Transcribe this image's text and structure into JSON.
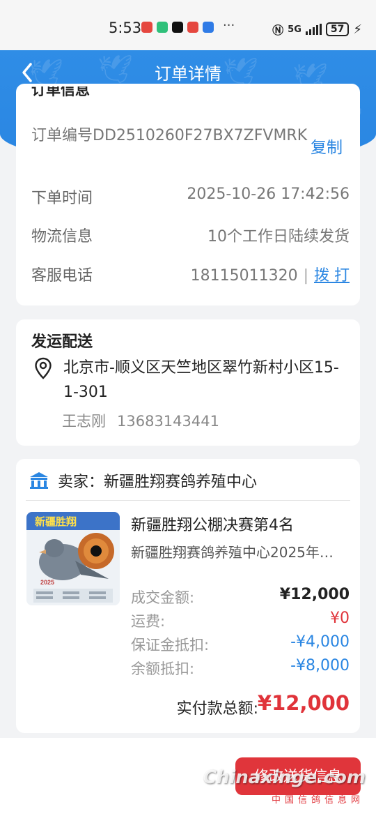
{
  "status_bar": {
    "time": "5:53",
    "more": "···",
    "network": "5G",
    "battery": "57"
  },
  "header": {
    "title": "订单详情"
  },
  "order": {
    "section_title": "订单信息",
    "order_no": "订单编号DD2510260F27BX7ZFVMRK",
    "copy_label": "复制",
    "time_label": "下单时间",
    "time_value": "2025-10-26 17:42:56",
    "logistics_label": "物流信息",
    "logistics_value": "10个工作日陆续发货",
    "service_label": "客服电话",
    "service_phone": "18115011320",
    "separator": "|",
    "dial_label": "拨 打"
  },
  "shipping": {
    "title": "发运配送",
    "address": "北京市-顺义区天竺地区翠竹新村小区15-1-301",
    "receiver_name": "王志刚",
    "receiver_phone": "13683143441"
  },
  "seller": {
    "label": "卖家：新疆胜翔赛鸽养殖中心",
    "product_name": "新疆胜翔公棚决赛第4名",
    "product_desc": "新疆胜翔赛鸽养殖中心2025年…",
    "poster_title": "新疆胜翔",
    "poster_year": "2025",
    "deal_label": "成交金额:",
    "deal_value": "¥12,000",
    "shipping_label": "运费:",
    "shipping_value": "¥0",
    "deposit_label": "保证金抵扣:",
    "deposit_value": "-¥4,000",
    "balance_label": "余额抵扣:",
    "balance_value": "-¥8,000",
    "total_label": "实付款总额:",
    "total_value": "¥12,000"
  },
  "footer": {
    "modify_label": "修改送货信息",
    "watermark": "Chinaxinge.com",
    "watermark_sub": "中国信鸽信息网"
  },
  "colors": {
    "primary": "#2a86e2",
    "price_red": "#e0333a",
    "discount_blue": "#2a86e2"
  },
  "icons": [
    "back-icon",
    "location-pin-icon",
    "store-icon"
  ]
}
